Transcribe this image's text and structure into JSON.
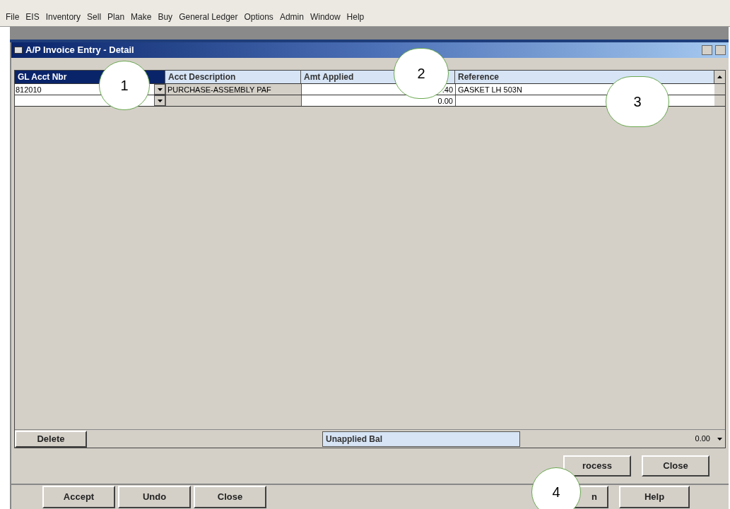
{
  "menu": [
    {
      "label": "File"
    },
    {
      "label": "EIS"
    },
    {
      "label": "Inventory"
    },
    {
      "label": "Sell"
    },
    {
      "label": "Plan"
    },
    {
      "label": "Make"
    },
    {
      "label": "Buy"
    },
    {
      "label": "General Ledger"
    },
    {
      "label": "Options"
    },
    {
      "label": "Admin"
    },
    {
      "label": "Window"
    },
    {
      "label": "Help"
    }
  ],
  "window": {
    "title": "A/P Invoice Entry - Detail"
  },
  "table": {
    "columns": [
      {
        "label": "GL Acct Nbr",
        "selected": true
      },
      {
        "label": "Acct Description",
        "selected": false
      },
      {
        "label": "Amt Applied",
        "selected": false
      },
      {
        "label": "Reference",
        "selected": false
      }
    ],
    "rows": [
      {
        "acct": "812010",
        "description": "PURCHASE-ASSEMBLY PAF",
        "amount": ".40",
        "reference": "GASKET LH 503N"
      },
      {
        "acct": "",
        "description": "",
        "amount": "0.00",
        "reference": ""
      }
    ]
  },
  "delete_button": "Delete",
  "unapplied": {
    "label": "Unapplied Bal",
    "value": "0.00"
  },
  "detail_buttons": [
    "rocess",
    "Close"
  ],
  "footer_left": [
    "Accept",
    "Undo",
    "Close"
  ],
  "footer_right": [
    "n",
    "Help"
  ],
  "callouts": [
    "1",
    "2",
    "3",
    "4"
  ]
}
